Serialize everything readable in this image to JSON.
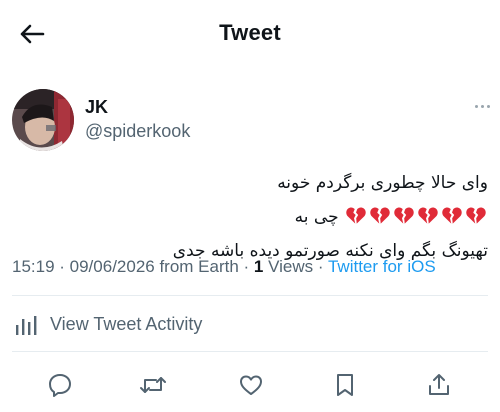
{
  "header": {
    "title": "Tweet"
  },
  "user": {
    "name": "JK",
    "handle": "@spiderkook"
  },
  "tweet": {
    "text_line1_prefix": "وای حالا چطوری برگردم خونه",
    "hearts": 6,
    "text_line1_suffix": "چی به",
    "text_line2": "تهیونگ بگم وای نکنه صورتمو دیده باشه جدی"
  },
  "meta": {
    "timestamp": "15:19 · 09/06/2026 from Earth · ",
    "views_count": "1",
    "views_label": " Views · ",
    "source": "Twitter for iOS"
  },
  "activity": {
    "label": "View Tweet Activity"
  },
  "icons": [
    "back-arrow-icon",
    "more-icon",
    "broken-heart-icon",
    "analytics-icon",
    "reply-icon",
    "retweet-icon",
    "like-icon",
    "bookmark-icon",
    "share-icon"
  ],
  "colors": {
    "link": "#1d9bf0",
    "secondary_text": "#536471",
    "broken_heart": "#e02b38"
  }
}
